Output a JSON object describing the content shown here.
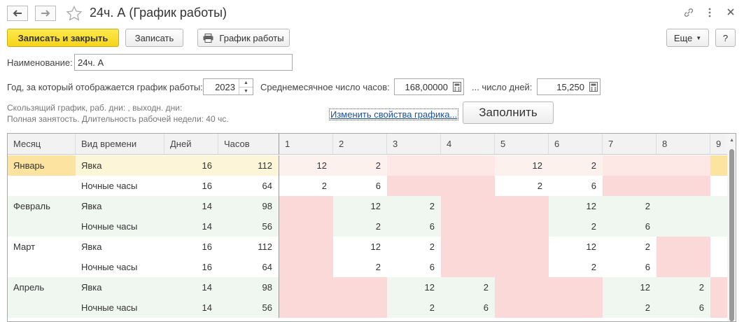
{
  "window": {
    "title": "24ч. А (График работы)"
  },
  "toolbar": {
    "save_close_label": "Записать и закрыть",
    "save_label": "Записать",
    "schedule_label": "График работы",
    "more_label": "Еще",
    "help_label": "?"
  },
  "form": {
    "name_label": "Наименование:",
    "name_value": "24ч. А",
    "year_label": "Год, за который отображается график работы:",
    "year_value": "2023",
    "avg_hours_label": "Среднемесячное число часов:",
    "avg_hours_value": "168,00000",
    "days_label": "... число дней:",
    "days_value": "15,250",
    "info_line1": "Скользящий график, раб. дни: , выходн. дни:",
    "info_line2": "Полная занятость. Длительность рабочей недели: 40 чс.",
    "change_link": "Изменить свойства графика...",
    "fill_label": "Заполнить"
  },
  "grid": {
    "columns": [
      "Месяц",
      "Вид времени",
      "Дней",
      "Часов",
      "1",
      "2",
      "3",
      "4",
      "5",
      "6",
      "7",
      "8",
      "9"
    ],
    "rows": [
      {
        "month": "Январь",
        "type": "Явка",
        "days": "16",
        "hours": "112",
        "d": [
          "12",
          "2",
          "",
          "",
          "12",
          "2",
          "",
          "",
          ""
        ]
      },
      {
        "month": "",
        "type": "Ночные часы",
        "days": "16",
        "hours": "64",
        "d": [
          "2",
          "6",
          "",
          "",
          "2",
          "6",
          "",
          "",
          ""
        ]
      },
      {
        "month": "Февраль",
        "type": "Явка",
        "days": "14",
        "hours": "98",
        "d": [
          "",
          "12",
          "2",
          "",
          "",
          "12",
          "2",
          "",
          ""
        ]
      },
      {
        "month": "",
        "type": "Ночные часы",
        "days": "14",
        "hours": "56",
        "d": [
          "",
          "2",
          "6",
          "",
          "",
          "2",
          "6",
          "",
          ""
        ]
      },
      {
        "month": "Март",
        "type": "Явка",
        "days": "16",
        "hours": "112",
        "d": [
          "",
          "12",
          "2",
          "",
          "",
          "12",
          "2",
          "",
          ""
        ]
      },
      {
        "month": "",
        "type": "Ночные часы",
        "days": "16",
        "hours": "64",
        "d": [
          "",
          "2",
          "6",
          "",
          "",
          "2",
          "6",
          "",
          ""
        ]
      },
      {
        "month": "Апрель",
        "type": "Явка",
        "days": "14",
        "hours": "98",
        "d": [
          "",
          "",
          "12",
          "2",
          "",
          "",
          "12",
          "2",
          ""
        ]
      },
      {
        "month": "",
        "type": "Ночные часы",
        "days": "14",
        "hours": "56",
        "d": [
          "",
          "",
          "2",
          "6",
          "",
          "",
          "2",
          "6",
          ""
        ]
      }
    ]
  },
  "colors": {
    "selected_row": "#fdf5d7",
    "selected_month": "#fce4a0",
    "group_even": "#ffffff",
    "group_odd": "#f0f7f1",
    "day_off": "#fbd9d9",
    "day_off_selected": "#fde8e5",
    "primary_button": "#f5d41a"
  }
}
